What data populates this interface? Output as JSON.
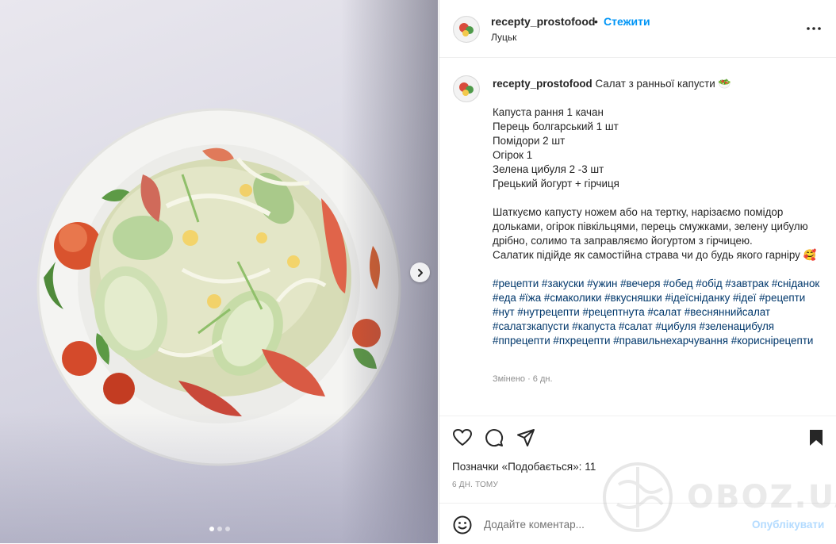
{
  "header": {
    "username": "recepty_prostofood",
    "separator": "•",
    "follow_label": "Стежити",
    "location": "Луцьк"
  },
  "caption": {
    "username": "recepty_prostofood",
    "title": "Салат з ранньої капусти 🥗",
    "ingredients": [
      "Капуста рання 1 качан",
      "Перець болгарський 1 шт",
      "Помідори 2 шт",
      "Огірок 1",
      "Зелена цибуля 2 -3 шт",
      "Грецький йогурт + гірчиця"
    ],
    "instructions": "Шаткуємо капусту ножем або на тертку, нарізаємо помідор дольками, огірок півкільцями, перець смужками, зелену цибулю дрібно, солимо та заправляємо йогуртом з гірчицею.",
    "note": "Салатик підійде як самостійна страва чи до будь якого гарніру 🥰",
    "hashtags": "#рецепти #закуски #ужин #вечеря #обед #обід #завтрак #сніданок #еда #їжа #смаколики #вкусняшки #ідеїсніданку #ідеї #рецепти #нут #нутрецепти #рецептнута #салат #весняннийсалат #салатзкапусти #капуста #салат #цибуля #зеленацибуля #ппрецепти #пхрецепти #правильнехарчування #кориснірецепти",
    "edited": "Змінено · 6 дн."
  },
  "actions": {
    "likes": "Позначки «Подобається»: 11",
    "time": "6 ДН. ТОМУ"
  },
  "comment": {
    "placeholder": "Додайте коментар...",
    "publish_label": "Опублікувати"
  },
  "carousel": {
    "current": 1,
    "total": 3
  },
  "watermark": "OBOZ.UA",
  "colors": {
    "link": "#0095f6",
    "hashtag": "#00376b",
    "muted": "#8e8e8e"
  }
}
